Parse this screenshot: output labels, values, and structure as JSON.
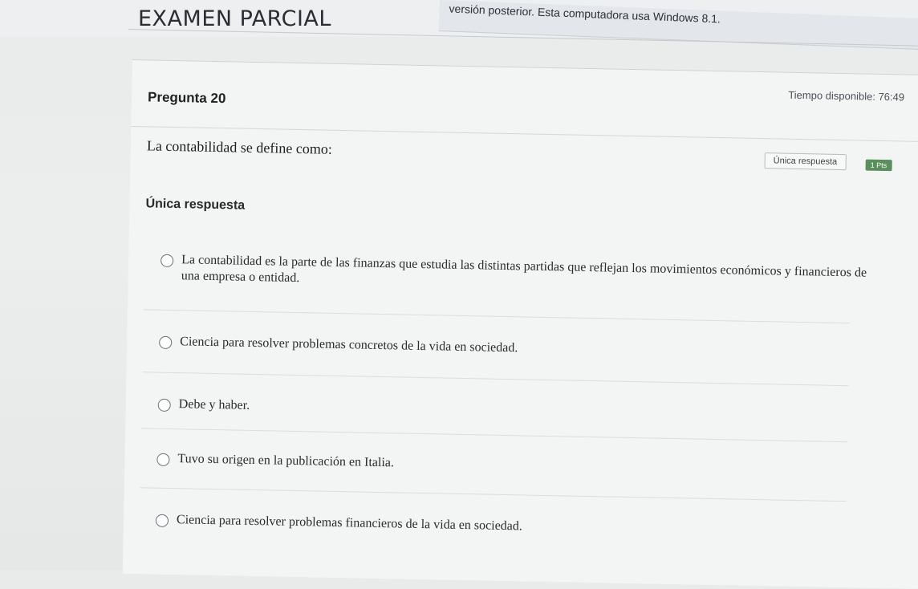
{
  "exam": {
    "title": "EXAMEN PARCIAL",
    "warning_text": "versión posterior. Esta computadora usa Windows 8.1.",
    "time_label": "Tiempo disponible: 76:49"
  },
  "question": {
    "number_label": "Pregunta 20",
    "text": "La contabilidad se define como:",
    "type_badge": "Única respuesta",
    "points_badge": "1 Pts",
    "answer_type_heading": "Única respuesta",
    "options": [
      {
        "label": "La contabilidad es la parte de las finanzas que estudia las distintas partidas que reflejan los movimientos económicos y financieros de una empresa o entidad."
      },
      {
        "label": "Ciencia para resolver problemas concretos de la vida en sociedad."
      },
      {
        "label": "Debe y haber."
      },
      {
        "label": "Tuvo su origen en la publicación en Italia."
      },
      {
        "label": "Ciencia para resolver problemas financieros de la vida en sociedad."
      }
    ]
  },
  "colors": {
    "points_badge": "#5a8f5d",
    "page_background": "#eceeee"
  }
}
